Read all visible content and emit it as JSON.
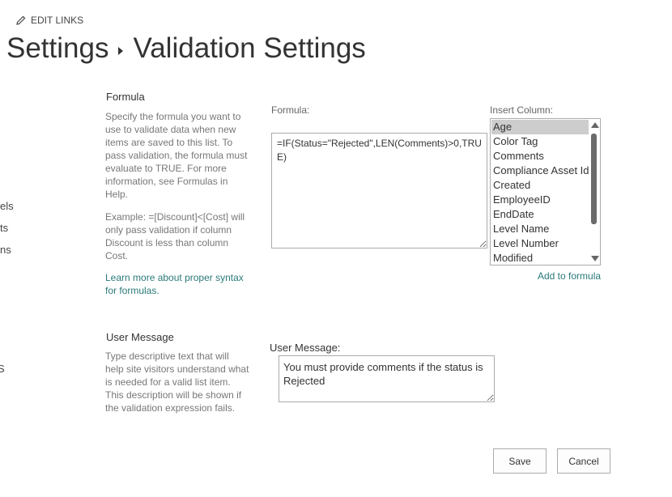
{
  "header": {
    "edit_links": "EDIT LINKS",
    "breadcrumb_parent": "Settings",
    "breadcrumb_current": "Validation Settings"
  },
  "left_nav": [
    "els",
    "ts",
    "ns",
    "S"
  ],
  "formula_section": {
    "title": "Formula",
    "description": "Specify the formula you want to use to validate data when new items are saved to this list. To pass validation, the formula must evaluate to TRUE. For more information, see Formulas in Help.",
    "example": "Example: =[Discount]<[Cost] will only pass validation if column Discount is less than column Cost.",
    "learn_more": "Learn more about proper syntax for formulas.",
    "formula_label": "Formula:",
    "formula_value": "=IF(Status=\"Rejected\",LEN(Comments)>0,TRUE)"
  },
  "insert_column": {
    "label": "Insert Column:",
    "items": [
      "Age",
      "Color Tag",
      "Comments",
      "Compliance Asset Id",
      "Created",
      "EmployeeID",
      "EndDate",
      "Level Name",
      "Level Number",
      "Modified"
    ],
    "selected": "Age",
    "add_link": "Add to formula"
  },
  "user_message_section": {
    "title": "User Message",
    "description": "Type descriptive text that will help site visitors understand what is needed for a valid list item. This description will be shown if the validation expression fails.",
    "label": "User Message:",
    "value": "You must provide comments if the status is Rejected"
  },
  "buttons": {
    "save": "Save",
    "cancel": "Cancel"
  }
}
